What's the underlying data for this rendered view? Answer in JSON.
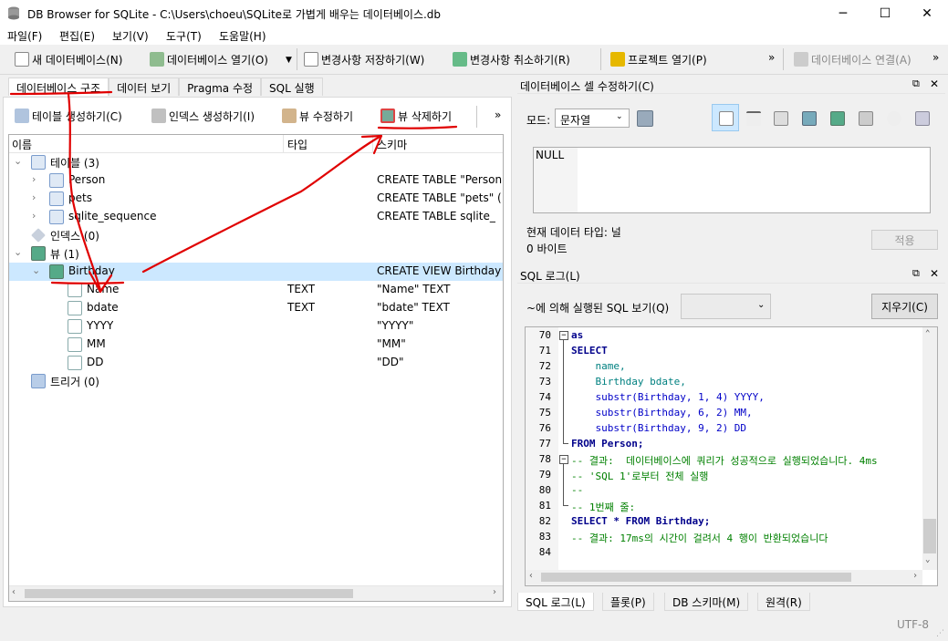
{
  "window": {
    "title": "DB Browser for SQLite - C:\\Users\\choeu\\SQLite로 가볍게 배우는 데이터베이스.db",
    "minimize": "─",
    "maximize": "☐",
    "close": "✕"
  },
  "menu": [
    "파일(F)",
    "편집(E)",
    "보기(V)",
    "도구(T)",
    "도움말(H)"
  ],
  "toolbar": {
    "new_db": "새 데이터베이스(N)",
    "open_db": "데이터베이스 열기(O)",
    "write_changes": "변경사항 저장하기(W)",
    "revert_changes": "변경사항 취소하기(R)",
    "open_project": "프로젝트 열기(P)",
    "more": "»",
    "db_connect": "데이터베이스 연결(A)",
    "more2": "»"
  },
  "tabs": [
    "데이터베이스 구조",
    "데이터 보기",
    "Pragma 수정",
    "SQL 실행"
  ],
  "structure_toolbar": {
    "create_table": "테이블 생성하기(C)",
    "create_index": "인덱스 생성하기(I)",
    "modify_view": "뷰 수정하기",
    "delete_view": "뷰 삭제하기",
    "more": "»"
  },
  "tree": {
    "headers": [
      "이름",
      "타입",
      "스키마"
    ],
    "rows": [
      {
        "name": "테이블 (3)",
        "type": "",
        "schema": ""
      },
      {
        "name": "Person",
        "type": "",
        "schema": "CREATE TABLE \"Person"
      },
      {
        "name": "pets",
        "type": "",
        "schema": "CREATE TABLE \"pets\" ("
      },
      {
        "name": "sqlite_sequence",
        "type": "",
        "schema": "CREATE TABLE sqlite_"
      },
      {
        "name": "인덱스 (0)",
        "type": "",
        "schema": ""
      },
      {
        "name": "뷰 (1)",
        "type": "",
        "schema": ""
      },
      {
        "name": "Birthday",
        "type": "",
        "schema": "CREATE VIEW Birthday"
      },
      {
        "name": "Name",
        "type": "TEXT",
        "schema": "\"Name\" TEXT"
      },
      {
        "name": "bdate",
        "type": "TEXT",
        "schema": "\"bdate\" TEXT"
      },
      {
        "name": "YYYY",
        "type": "",
        "schema": "\"YYYY\""
      },
      {
        "name": "MM",
        "type": "",
        "schema": "\"MM\""
      },
      {
        "name": "DD",
        "type": "",
        "schema": "\"DD\""
      },
      {
        "name": "트리거 (0)",
        "type": "",
        "schema": ""
      }
    ]
  },
  "cell_editor": {
    "title": "데이터베이스 셀 수정하기(C)",
    "mode_label": "모드:",
    "mode_value": "문자열",
    "content": "NULL",
    "type_label": "현재 데이터 타입: 널",
    "size_label": "0 바이트",
    "apply": "적용"
  },
  "sql_log": {
    "title": "SQL 로그(L)",
    "show_label": "~에 의해 실행된 SQL 보기(Q)",
    "clear": "지우기(C)",
    "lines": [
      {
        "n": "70",
        "t": "as"
      },
      {
        "n": "71",
        "t": "SELECT"
      },
      {
        "n": "72",
        "t": "    name,"
      },
      {
        "n": "73",
        "t": "    Birthday bdate,"
      },
      {
        "n": "74",
        "t": "    substr(Birthday, 1, 4) YYYY,"
      },
      {
        "n": "75",
        "t": "    substr(Birthday, 6, 2) MM,"
      },
      {
        "n": "76",
        "t": "    substr(Birthday, 9, 2) DD"
      },
      {
        "n": "77",
        "t": "FROM Person;"
      },
      {
        "n": "78",
        "t": "-- 결과:  데이터베이스에 쿼리가 성공적으로 실행되었습니다. 4ms"
      },
      {
        "n": "79",
        "t": "-- 'SQL 1'로부터 전체 실행"
      },
      {
        "n": "80",
        "t": "--"
      },
      {
        "n": "81",
        "t": "-- 1번째 줄:"
      },
      {
        "n": "82",
        "t": "SELECT * FROM Birthday;"
      },
      {
        "n": "83",
        "t": "-- 결과: 17ms의 시간이 걸려서 4 행이 반환되었습니다"
      },
      {
        "n": "84",
        "t": ""
      }
    ]
  },
  "bottom_tabs": [
    "SQL 로그(L)",
    "플롯(P)",
    "DB 스키마(M)",
    "원격(R)"
  ],
  "status": {
    "encoding": "UTF-8"
  },
  "colors": {
    "annotation": "#e00000",
    "selection": "#cce8ff"
  }
}
